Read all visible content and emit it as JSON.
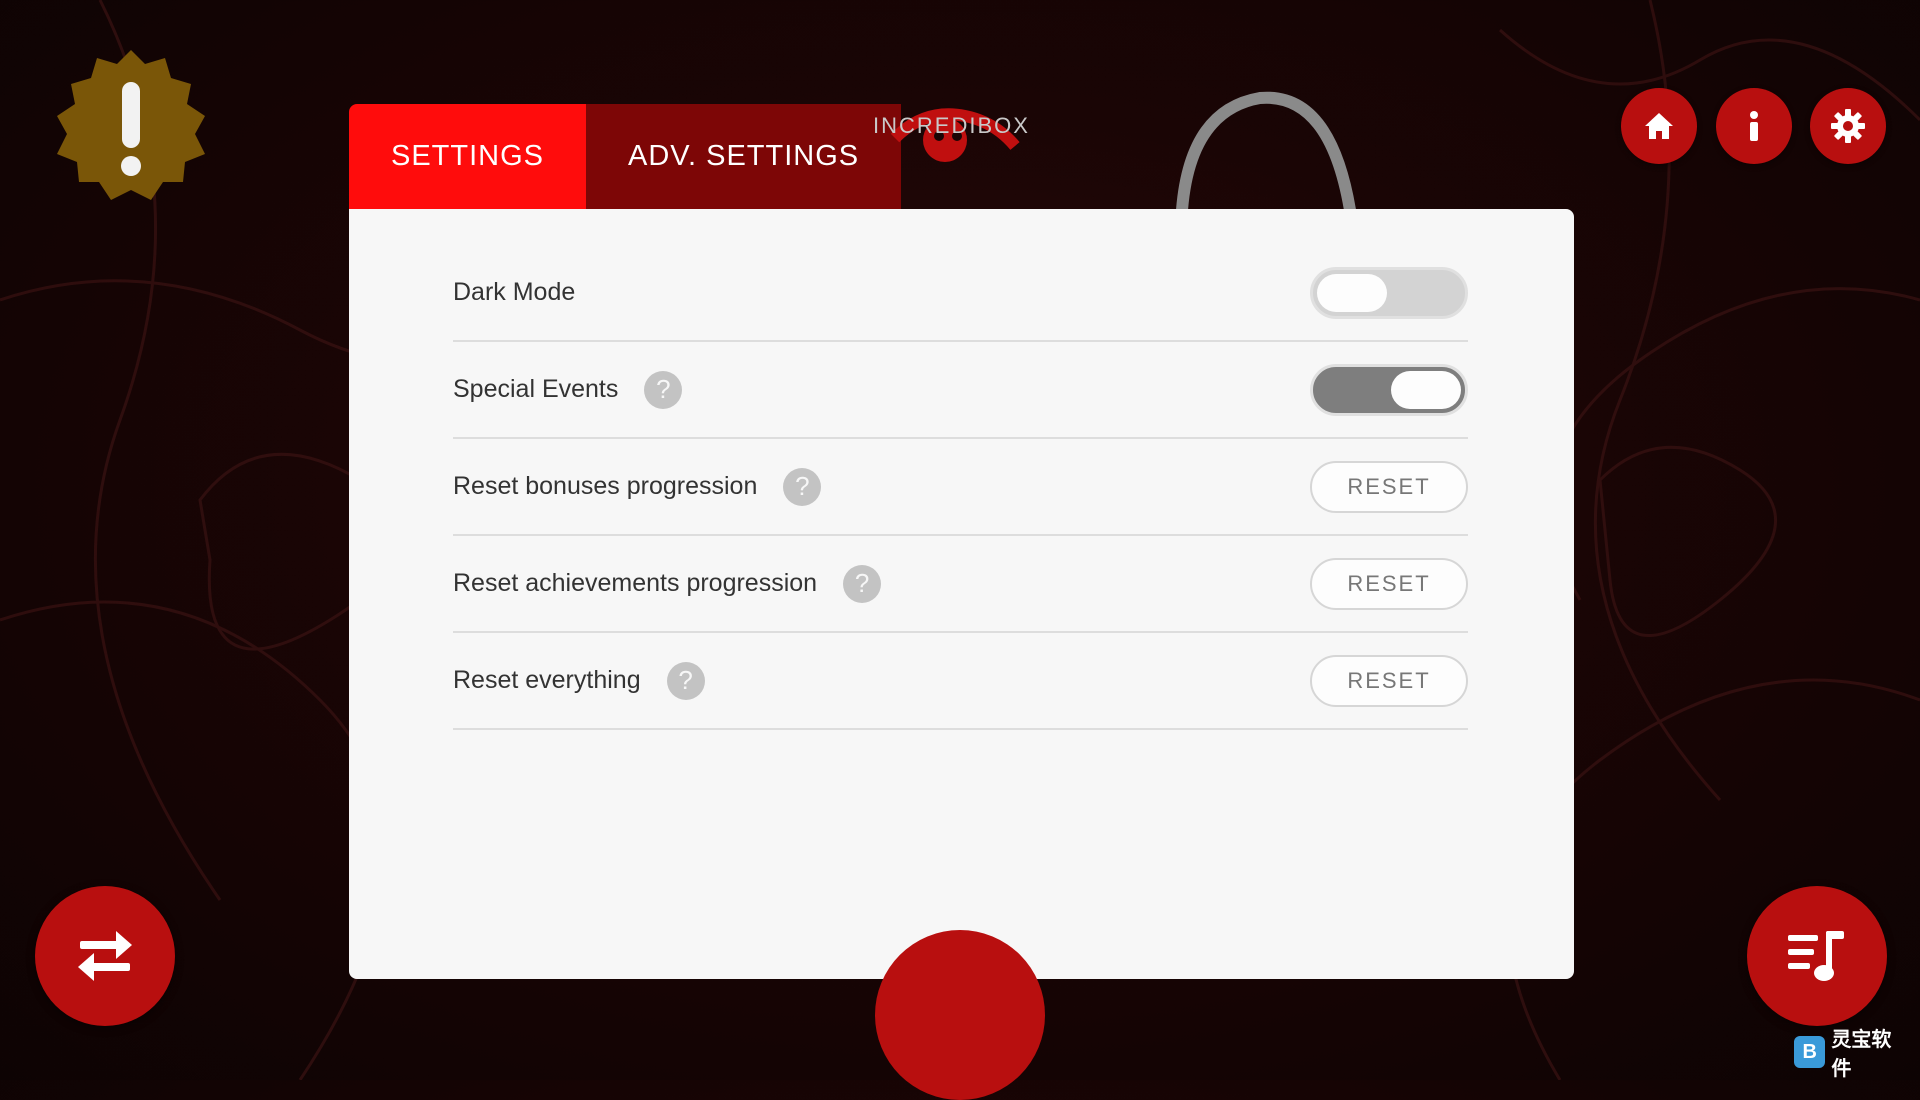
{
  "brand": {
    "name": "INCREDIBOX"
  },
  "tabs": [
    {
      "label": "SETTINGS",
      "active": true
    },
    {
      "label": "ADV. SETTINGS",
      "active": false
    }
  ],
  "settings": {
    "rows": [
      {
        "label": "Dark Mode",
        "control": "toggle",
        "on": false,
        "help": false
      },
      {
        "label": "Special Events",
        "control": "toggle",
        "on": true,
        "help": true,
        "help_glyph": "?"
      },
      {
        "label": "Reset bonuses progression",
        "control": "button",
        "button_label": "RESET",
        "help": true,
        "help_glyph": "?"
      },
      {
        "label": "Reset achievements progression",
        "control": "button",
        "button_label": "RESET",
        "help": true,
        "help_glyph": "?"
      },
      {
        "label": "Reset everything",
        "control": "button",
        "button_label": "RESET",
        "help": true,
        "help_glyph": "?"
      }
    ]
  },
  "icons": {
    "alert": "exclamation-badge-icon",
    "home": "home-icon",
    "info": "info-icon",
    "settings": "gear-icon",
    "swap": "swap-arrows-icon",
    "playlist": "music-playlist-icon"
  },
  "watermark": {
    "text": "灵宝软件"
  },
  "colors": {
    "accent": "#ff0c0c",
    "tab_inactive": "#7d0606",
    "button_red": "#b80f0f",
    "alert_gold": "#7a5608",
    "panel": "#f7f7f7"
  }
}
